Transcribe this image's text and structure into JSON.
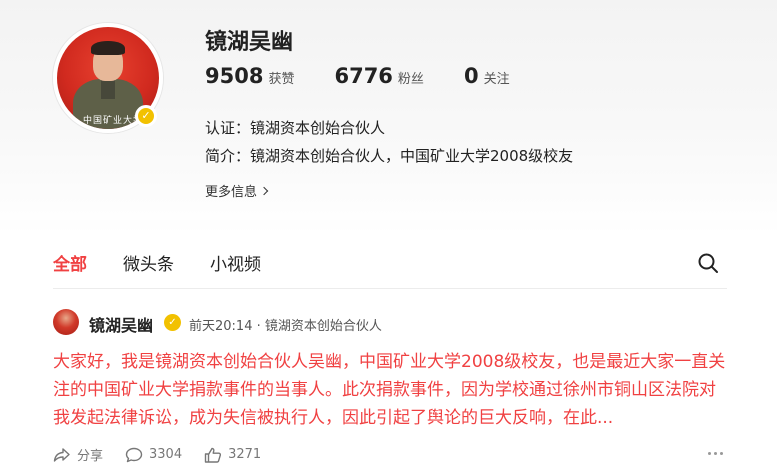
{
  "profile": {
    "name": "镜湖吴幽",
    "avatar_caption": "中国矿业大学",
    "stats": [
      {
        "value": "9508",
        "label": "获赞"
      },
      {
        "value": "6776",
        "label": "粉丝"
      },
      {
        "value": "0",
        "label": "关注"
      }
    ],
    "certification": "认证：镜湖资本创始合伙人",
    "intro": "简介：镜湖资本创始合伙人，中国矿业大学2008级校友",
    "more_info": "更多信息",
    "verified_icon": "✓"
  },
  "tabs": [
    {
      "label": "全部",
      "active": true
    },
    {
      "label": "微头条",
      "active": false
    },
    {
      "label": "小视频",
      "active": false
    }
  ],
  "post": {
    "author": "镜湖吴幽",
    "meta": "前天20:14 · 镜湖资本创始合伙人",
    "body": "大家好，我是镜湖资本创始合伙人吴幽，中国矿业大学2008级校友，也是最近大家一直关注的中国矿业大学捐款事件的当事人。此次捐款事件，因为学校通过徐州市铜山区法院对我发起法律诉讼，成为失信被执行人，因此引起了舆论的巨大反响，在此...",
    "actions": {
      "share_label": "分享",
      "comments": "3304",
      "likes": "3271"
    }
  },
  "colors": {
    "accent": "#f04142",
    "verified": "#f2c100"
  },
  "icons": {
    "search": "search-icon",
    "share": "share-icon",
    "comment": "comment-icon",
    "like": "thumbs-up-icon",
    "more": "more-dots-icon"
  }
}
